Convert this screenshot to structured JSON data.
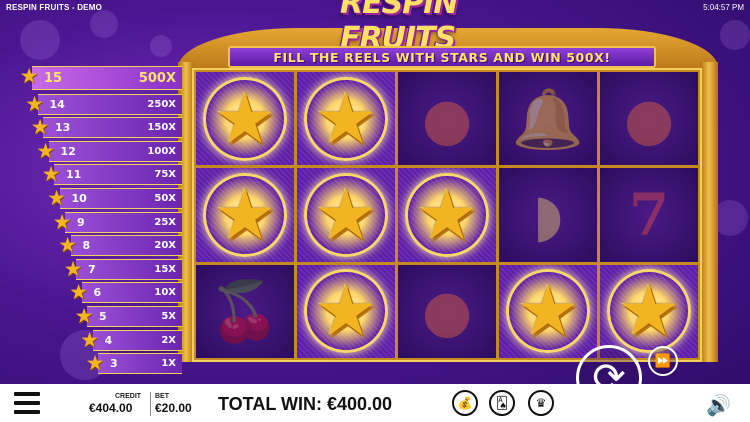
{
  "window": {
    "title": "RESPIN FRUITS - DEMO",
    "clock": "5:04:57 PM"
  },
  "logo": {
    "text": "RESPIN FRUITS"
  },
  "banner": {
    "text": "FILL THE REELS WITH STARS AND WIN 500X!"
  },
  "paytable": [
    {
      "count": "15",
      "pay": "500X"
    },
    {
      "count": "14",
      "pay": "250X"
    },
    {
      "count": "13",
      "pay": "150X"
    },
    {
      "count": "12",
      "pay": "100X"
    },
    {
      "count": "11",
      "pay": "75X"
    },
    {
      "count": "10",
      "pay": "50X"
    },
    {
      "count": "9",
      "pay": "25X"
    },
    {
      "count": "8",
      "pay": "20X"
    },
    {
      "count": "7",
      "pay": "15X"
    },
    {
      "count": "6",
      "pay": "10X"
    },
    {
      "count": "5",
      "pay": "5X"
    },
    {
      "count": "4",
      "pay": "2X"
    },
    {
      "count": "3",
      "pay": "1X"
    }
  ],
  "reels": [
    [
      "star",
      "star",
      "orange",
      "bell",
      "orange"
    ],
    [
      "star",
      "star",
      "star",
      "lemon",
      "seven"
    ],
    [
      "cherry",
      "star",
      "orange",
      "star",
      "star"
    ]
  ],
  "symbols": {
    "star": {
      "glyph": "★",
      "icon": "star-icon"
    },
    "orange": {
      "glyph": "●",
      "icon": "orange-icon"
    },
    "bell": {
      "glyph": "🔔",
      "icon": "bell-icon"
    },
    "lemon": {
      "glyph": "◗",
      "icon": "lemon-icon"
    },
    "cherry": {
      "glyph": "🍒",
      "icon": "cherry-icon"
    },
    "seven": {
      "glyph": "7",
      "icon": "seven-icon"
    }
  },
  "bottom": {
    "credit_label": "CREDIT",
    "credit_value": "€404.00",
    "bet_label": "BET",
    "bet_value": "€20.00",
    "total_win": "TOTAL WIN: €400.00"
  },
  "colors": {
    "accent_gold": "#f2b421",
    "frame_gold": "#e6a735",
    "purple": "#5d1aa8"
  }
}
